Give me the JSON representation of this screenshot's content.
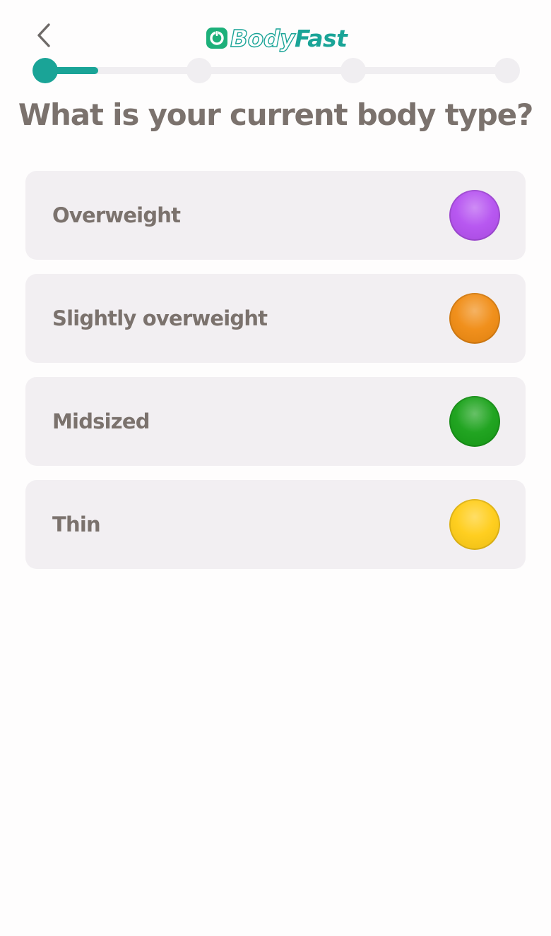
{
  "header": {
    "back_icon": "chevron-left-icon",
    "logo": {
      "part1": "Body",
      "part2": "Fast",
      "icon": "power-ring-icon"
    }
  },
  "progress": {
    "total_steps": 4,
    "current_step": 1,
    "fill_fraction": 0.12
  },
  "question": "What is your current body type?",
  "options": [
    {
      "label": "Overweight",
      "icon": "purple-circle-icon",
      "color": "#b44ff0"
    },
    {
      "label": "Slightly overweight",
      "icon": "orange-circle-icon",
      "color": "#f08a10"
    },
    {
      "label": "Midsized",
      "icon": "green-circle-icon",
      "color": "#16a016"
    },
    {
      "label": "Thin",
      "icon": "yellow-circle-icon",
      "color": "#ffcc14"
    }
  ],
  "colors": {
    "accent": "#1aa497",
    "text": "#7b726d",
    "card_bg": "#f2eff2",
    "track": "#f0eef1"
  }
}
